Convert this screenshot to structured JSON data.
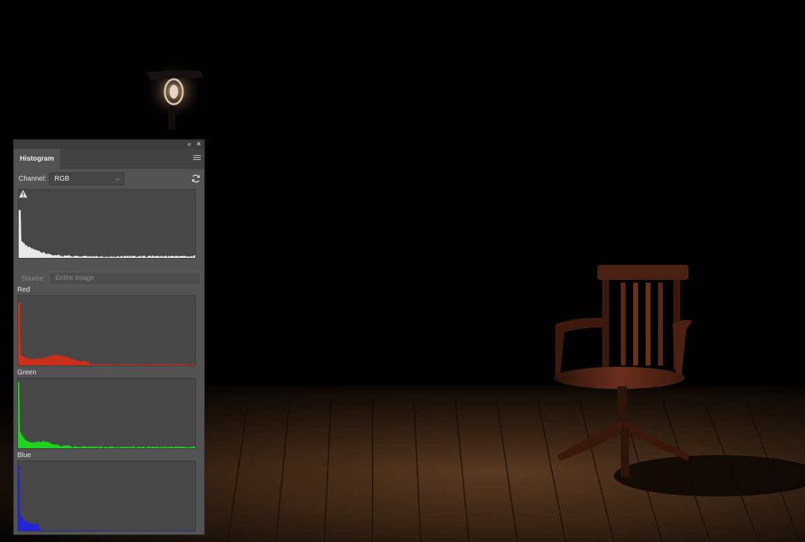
{
  "panel": {
    "tab_label": "Histogram",
    "collapse_glyph": "«",
    "close_glyph": "×",
    "menu_icon": "panel-menu-icon",
    "channel_label": "Channel:",
    "channel_value": "RGB",
    "refresh_icon": "refresh-icon",
    "warning_icon": "cache-warning-icon",
    "source_label": "Source:",
    "source_value": "Entire Image"
  },
  "channels": [
    {
      "name": "Red",
      "color": "#c8301b"
    },
    {
      "name": "Green",
      "color": "#1ed31e"
    },
    {
      "name": "Blue",
      "color": "#2424d8"
    }
  ],
  "composite_color": "#e8e8e8"
}
